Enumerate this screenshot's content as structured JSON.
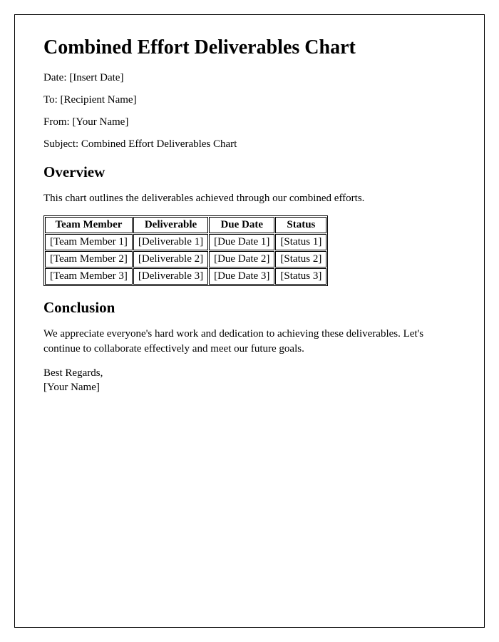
{
  "title": "Combined Effort Deliverables Chart",
  "meta": {
    "date_label": "Date: ",
    "date_value": "[Insert Date]",
    "to_label": "To: ",
    "to_value": "[Recipient Name]",
    "from_label": "From: ",
    "from_value": "[Your Name]",
    "subject_label": "Subject: ",
    "subject_value": "Combined Effort Deliverables Chart"
  },
  "overview": {
    "heading": "Overview",
    "text": "This chart outlines the deliverables achieved through our combined efforts."
  },
  "table": {
    "headers": {
      "member": "Team Member",
      "deliverable": "Deliverable",
      "due": "Due Date",
      "status": "Status"
    },
    "rows": [
      {
        "member": "[Team Member 1]",
        "deliverable": "[Deliverable 1]",
        "due": "[Due Date 1]",
        "status": "[Status 1]"
      },
      {
        "member": "[Team Member 2]",
        "deliverable": "[Deliverable 2]",
        "due": "[Due Date 2]",
        "status": "[Status 2]"
      },
      {
        "member": "[Team Member 3]",
        "deliverable": "[Deliverable 3]",
        "due": "[Due Date 3]",
        "status": "[Status 3]"
      }
    ]
  },
  "conclusion": {
    "heading": "Conclusion",
    "text": "We appreciate everyone's hard work and dedication to achieving these deliverables. Let's continue to collaborate effectively and meet our future goals."
  },
  "signoff": {
    "regards": "Best Regards,",
    "name": "[Your Name]"
  }
}
